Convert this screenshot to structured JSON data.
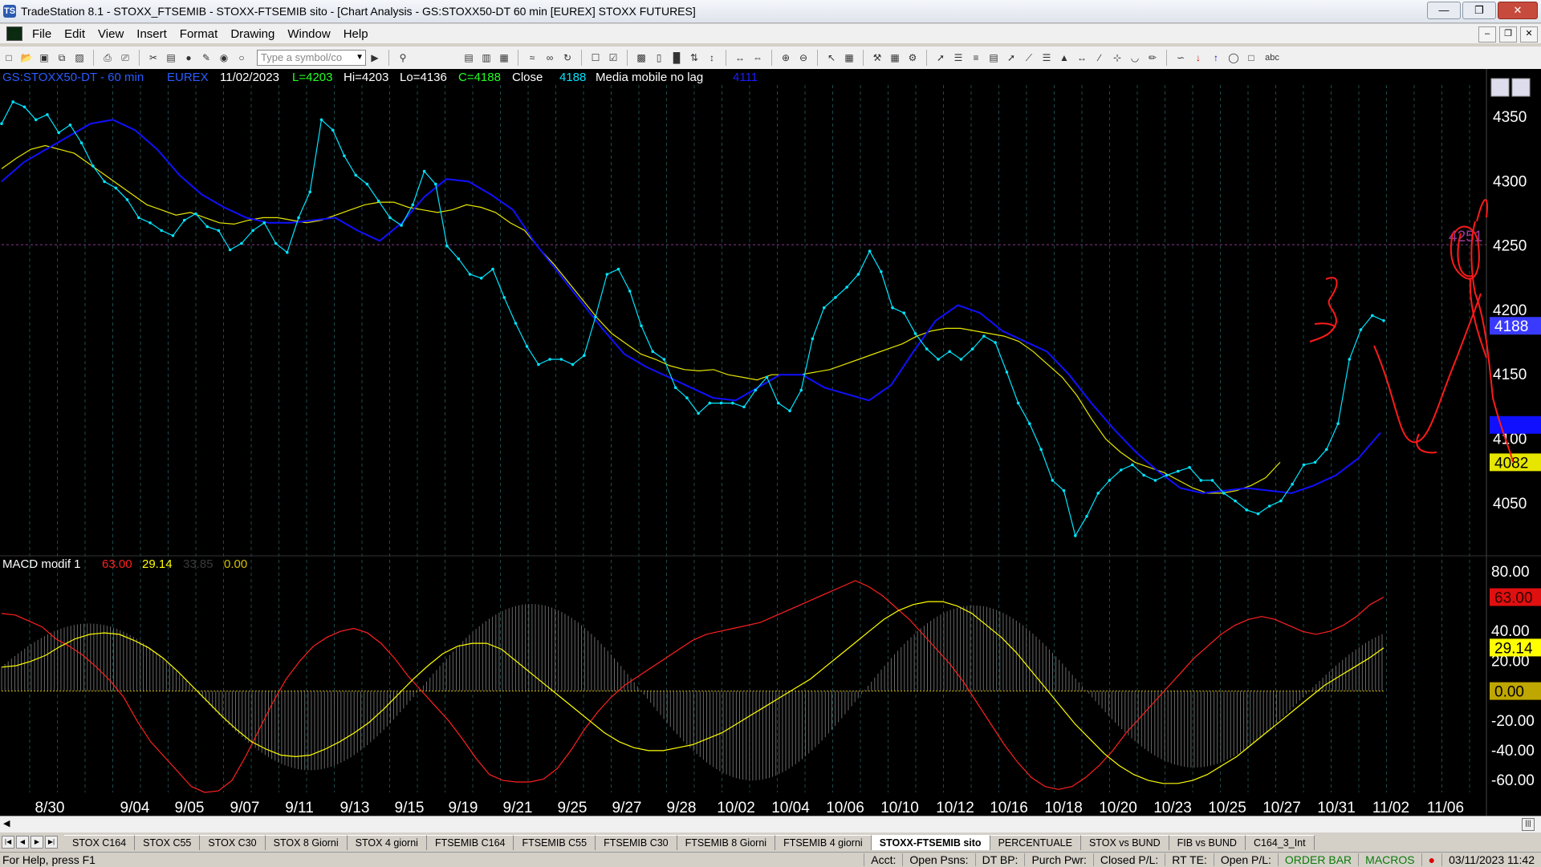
{
  "window": {
    "title": "TradeStation 8.1 - STOXX_FTSEMIB - STOXX-FTSEMIB sito - [Chart Analysis - GS:STOXX50-DT  60 min  [EUREX] STOXX FUTURES]",
    "app_icon": "TS"
  },
  "menu": [
    "File",
    "Edit",
    "View",
    "Insert",
    "Format",
    "Drawing",
    "Window",
    "Help"
  ],
  "toolbar": {
    "symbol_placeholder": "Type a symbol/co",
    "font_label": "abc"
  },
  "header": {
    "symbol": "GS:STOXX50-DT - 60 min",
    "exchange": "EUREX",
    "date": "11/02/2023",
    "last": "L=4203",
    "high": "Hi=4203",
    "low": "Lo=4136",
    "close": "C=4188",
    "close_label": "Close",
    "close_value": "4188",
    "indicator": "Media mobile no lag",
    "indicator_value": "4111",
    "ref_line_label": "4251"
  },
  "macd_header": {
    "name": "MACD modif 1",
    "v1": "63.00",
    "v2": "29.14",
    "v3": "33.85",
    "v4": "0.00"
  },
  "price_axis_labels": [
    "4350",
    "4300",
    "4250",
    "4200",
    "4150",
    "4100",
    "4050"
  ],
  "macd_axis_labels": [
    "80.00",
    "40.00",
    "20.00",
    "-20.00",
    "-40.00",
    "-60.00"
  ],
  "price_markers": {
    "close": "4188",
    "ma_blue": "4111",
    "ma_yellow": "4082",
    "macd_red": "63.00",
    "macd_yellow": "29.14",
    "macd_zero": "0.00"
  },
  "x_labels": [
    "8/30",
    "9/04",
    "9/05",
    "9/07",
    "9/11",
    "9/13",
    "9/15",
    "9/19",
    "9/21",
    "9/25",
    "9/27",
    "9/28",
    "10/02",
    "10/04",
    "10/06",
    "10/10",
    "10/12",
    "10/16",
    "10/18",
    "10/20",
    "10/23",
    "10/25",
    "10/27",
    "10/31",
    "11/02",
    "11/06"
  ],
  "colors": {
    "price": "#00e5ff",
    "ma_blue": "#1010ff",
    "ma_yellow": "#e6e600",
    "macd_red": "#ff2020",
    "macd_yellow": "#ffff00",
    "hist": "#6a6a6a",
    "annotation": "#ff1a1a",
    "ref_line": "#8a3a8a"
  },
  "chart_data": {
    "type": "line",
    "price_panel": {
      "ylim": [
        4010,
        4375
      ],
      "series": [
        {
          "values": [
            4345,
            4362,
            4358,
            4348,
            4352,
            4338,
            4344,
            4330,
            4312,
            4300,
            4295,
            4286,
            4272,
            4268,
            4262,
            4258,
            4270,
            4275,
            4265,
            4262,
            4247,
            4252,
            4262,
            4268,
            4252,
            4245,
            4272,
            4292,
            4348,
            4340,
            4320,
            4305,
            4298,
            4285,
            4272,
            4266,
            4282,
            4308,
            4298,
            4250,
            4240,
            4228,
            4225,
            4232,
            4210,
            4190,
            4172,
            4158,
            4162,
            4162,
            4158,
            4165,
            4195,
            4228,
            4232,
            4215,
            4188,
            4168,
            4162,
            4140,
            4132,
            4120,
            4128,
            4128,
            4128,
            4125,
            4138,
            4148,
            4128,
            4122,
            4138,
            4178,
            4202,
            4210,
            4218,
            4228,
            4246,
            4230,
            4202,
            4198,
            4182,
            4170,
            4162,
            4168,
            4162,
            4170,
            4180,
            4175,
            4152,
            4128,
            4112,
            4092,
            4068,
            4060,
            4025,
            4040,
            4058,
            4068,
            4076,
            4080,
            4072,
            4068,
            4072,
            4075,
            4078,
            4068,
            4068,
            4058,
            4052,
            4045,
            4042,
            4048,
            4052,
            4065,
            4080,
            4082,
            4092,
            4112,
            4162,
            4185,
            4196,
            4192
          ]
        },
        {
          "values": [
            4310,
            4318,
            4325,
            4328,
            4325,
            4322,
            4314,
            4306,
            4298,
            4290,
            4282,
            4278,
            4274,
            4276,
            4272,
            4268,
            4267,
            4270,
            4272,
            4272,
            4270,
            4268,
            4270,
            4274,
            4278,
            4282,
            4284,
            4284,
            4280,
            4278,
            4276,
            4278,
            4282,
            4280,
            4276,
            4268,
            4262,
            4248,
            4236,
            4222,
            4208,
            4194,
            4182,
            4174,
            4166,
            4162,
            4157,
            4154,
            4153,
            4154,
            4150,
            4148,
            4146,
            4150,
            4150,
            4150,
            4152,
            4154,
            4158,
            4162,
            4166,
            4170,
            4174,
            4180,
            4184,
            4186,
            4186,
            4184,
            4182,
            4180,
            4176,
            4168,
            4158,
            4148,
            4134,
            4116,
            4100,
            4090,
            4082,
            4078,
            4074,
            4068,
            4062,
            4058,
            4058,
            4060,
            4064,
            4070,
            4082
          ]
        },
        {
          "values": [
            4300,
            4315,
            4325,
            4335,
            4345,
            4348,
            4340,
            4325,
            4305,
            4290,
            4280,
            4272,
            4268,
            4268,
            4270,
            4272,
            4262,
            4254,
            4268,
            4288,
            4302,
            4300,
            4290,
            4278,
            4252,
            4230,
            4208,
            4186,
            4166,
            4156,
            4148,
            4140,
            4132,
            4130,
            4140,
            4150,
            4150,
            4140,
            4135,
            4130,
            4142,
            4168,
            4192,
            4204,
            4198,
            4184,
            4176,
            4168,
            4150,
            4128,
            4108,
            4090,
            4075,
            4062,
            4058,
            4060,
            4062,
            4060,
            4058,
            4064,
            4072,
            4085,
            4105
          ]
        }
      ],
      "ref_line": 4251
    },
    "macd_panel": {
      "ylim": [
        -68,
        88
      ],
      "series": [
        {
          "values": [
            52,
            51,
            47,
            43,
            35,
            30,
            24,
            16,
            7,
            -4,
            -20,
            -34,
            -44,
            -54,
            -64,
            -68,
            -67,
            -60,
            -44,
            -26,
            -8,
            8,
            20,
            30,
            36,
            40,
            42,
            39,
            32,
            22,
            10,
            0,
            -10,
            -20,
            -32,
            -45,
            -56,
            -60,
            -61,
            -61,
            -59,
            -52,
            -40,
            -26,
            -14,
            -4,
            4,
            10,
            16,
            22,
            28,
            34,
            38,
            40,
            42,
            44,
            46,
            50,
            54,
            58,
            62,
            66,
            70,
            74,
            70,
            64,
            56,
            48,
            38,
            28,
            18,
            6,
            -8,
            -22,
            -36,
            -48,
            -58,
            -64,
            -66,
            -64,
            -58,
            -50,
            -40,
            -28,
            -18,
            -8,
            2,
            12,
            22,
            30,
            38,
            44,
            48,
            50,
            48,
            44,
            40,
            38,
            40,
            44,
            50,
            58,
            63
          ]
        },
        {
          "values": [
            16,
            17,
            20,
            24,
            30,
            35,
            38,
            39,
            38,
            34,
            29,
            22,
            13,
            3,
            -7,
            -17,
            -26,
            -34,
            -39,
            -43,
            -44,
            -43,
            -39,
            -34,
            -28,
            -21,
            -12,
            -2,
            8,
            17,
            25,
            30,
            32,
            32,
            28,
            20,
            12,
            4,
            -4,
            -12,
            -20,
            -28,
            -34,
            -38,
            -40,
            -40,
            -38,
            -36,
            -32,
            -28,
            -22,
            -16,
            -10,
            -4,
            2,
            8,
            16,
            24,
            32,
            40,
            48,
            54,
            58,
            60,
            60,
            57,
            52,
            44,
            36,
            26,
            14,
            2,
            -10,
            -22,
            -32,
            -42,
            -50,
            -56,
            -60,
            -62,
            -62,
            -60,
            -56,
            -50,
            -44,
            -36,
            -28,
            -20,
            -12,
            -4,
            4,
            10,
            16,
            22,
            29
          ]
        }
      ]
    }
  }
}
